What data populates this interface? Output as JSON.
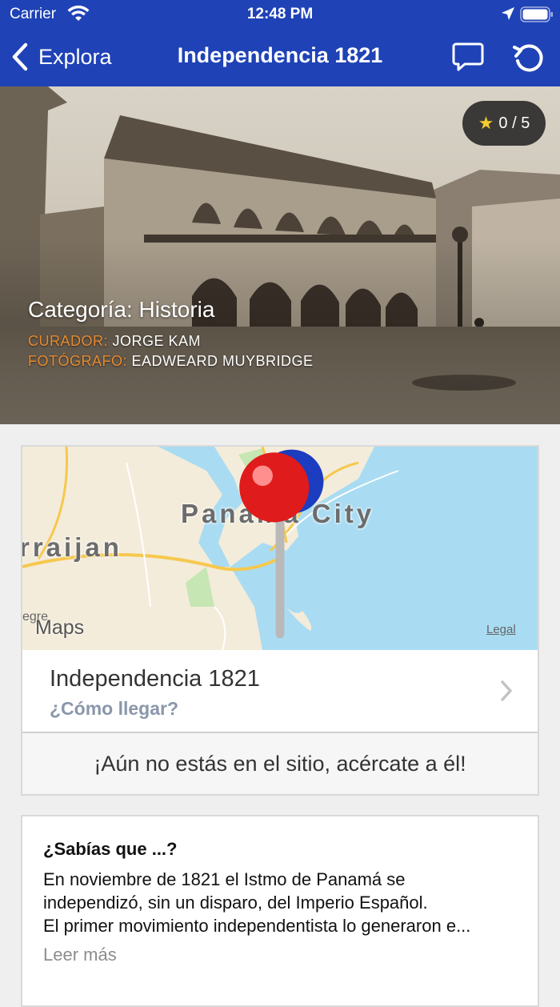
{
  "status_bar": {
    "carrier": "Carrier",
    "time": "12:48 PM"
  },
  "nav": {
    "back_label": "Explora",
    "title": "Independencia 1821",
    "icons": [
      "chevron-left-icon",
      "comment-icon",
      "refresh-icon"
    ]
  },
  "hero": {
    "rating": "0 / 5",
    "category": "Categoría: Historia",
    "curator_key": "CURADOR:",
    "curator_value": "JORGE KAM",
    "photographer_key": "FOTÓGRAFO:",
    "photographer_value": "EADWEARD MUYBRIDGE"
  },
  "map": {
    "city_label": "Panama City",
    "town_label": "rraijan",
    "town2_label": "egre",
    "logo": "Maps",
    "legal": "Legal"
  },
  "route": {
    "title": "Independencia 1821",
    "subtitle": "¿Cómo llegar?"
  },
  "notice": "¡Aún no estás en el sitio, acércate a él!",
  "info": {
    "title": "¿Sabías que ...?",
    "lines": [
      "En noviembre de 1821 el Istmo de Panamá se",
      "independizó, sin un disparo, del Imperio Español.",
      "El primer movimiento independentista lo generaron e..."
    ],
    "more": "Leer más"
  },
  "colors": {
    "nav_bg": "#1f42b6",
    "accent_orange": "#e58a2f",
    "link_gray": "#8a96aa",
    "water": "#a9dcf2"
  }
}
